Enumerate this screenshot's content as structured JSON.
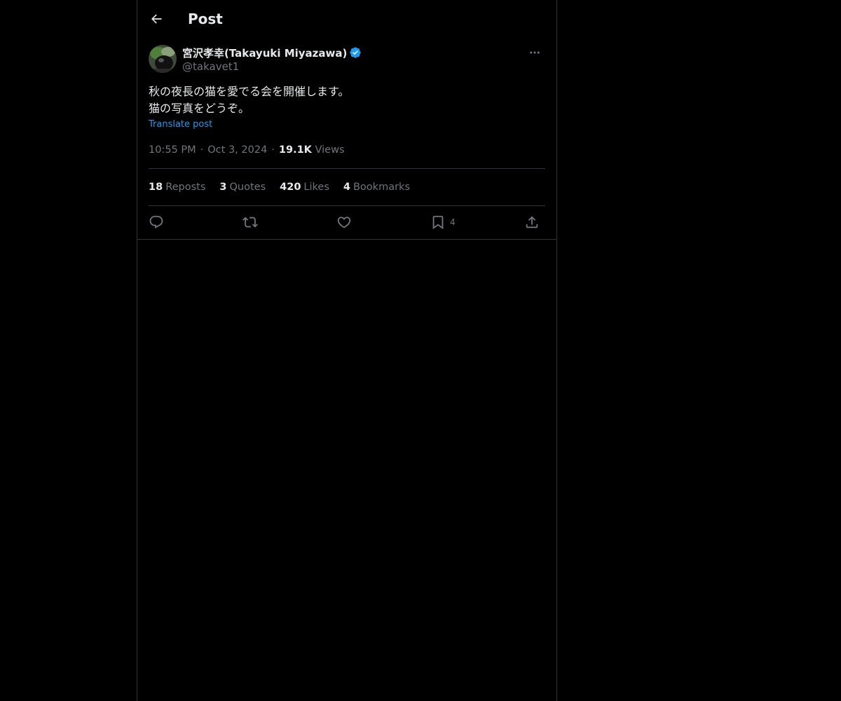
{
  "header": {
    "title": "Post",
    "back_icon": "arrow-left-icon"
  },
  "author": {
    "name": "宮沢孝幸(Takayuki Miyazawa)",
    "handle": "@takavet1",
    "verified": true,
    "verified_color": "#1d9bf0"
  },
  "post": {
    "lines": [
      "秋の夜長の猫を愛でる会を開催します。",
      "猫の写真をどうぞ。"
    ],
    "translate_label": "Translate post"
  },
  "meta": {
    "time": "10:55 PM",
    "date": "Oct 3, 2024",
    "views_count": "19.1K",
    "views_label": "Views",
    "separator": "·"
  },
  "stats": [
    {
      "count": "18",
      "label": "Reposts"
    },
    {
      "count": "3",
      "label": "Quotes"
    },
    {
      "count": "420",
      "label": "Likes"
    },
    {
      "count": "4",
      "label": "Bookmarks"
    }
  ],
  "actions": {
    "reply_icon": "reply-icon",
    "repost_icon": "repost-icon",
    "like_icon": "heart-icon",
    "bookmark_icon": "bookmark-icon",
    "bookmark_count": "4",
    "share_icon": "share-icon"
  },
  "colors": {
    "background": "#000000",
    "text": "#e7e9ea",
    "muted": "#71767b",
    "link": "#1d9bf0",
    "border": "#2f3336"
  }
}
